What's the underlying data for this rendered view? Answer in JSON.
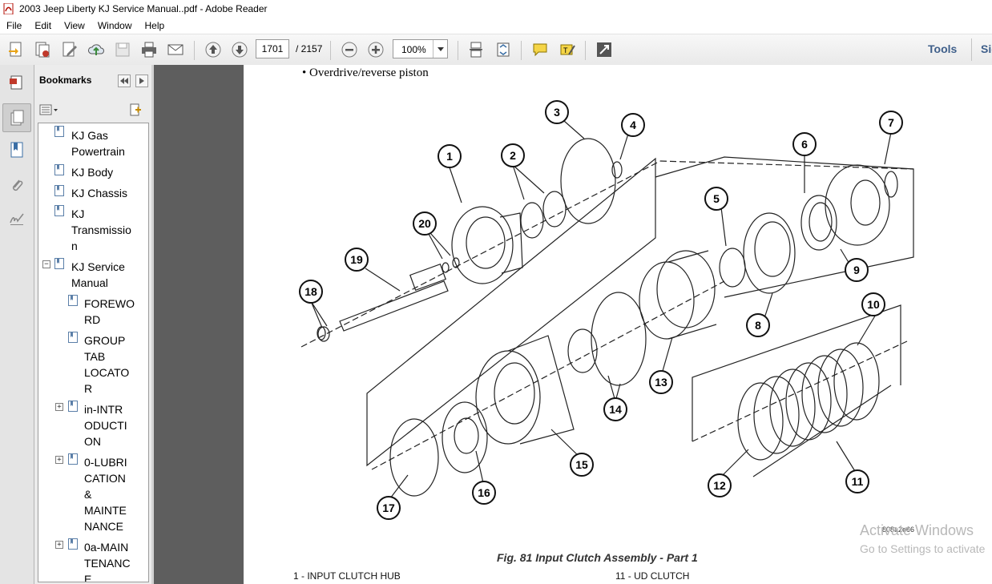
{
  "window": {
    "title": "2003 Jeep Liberty KJ Service Manual..pdf - Adobe Reader"
  },
  "menu": [
    "File",
    "Edit",
    "View",
    "Window",
    "Help"
  ],
  "toolbar": {
    "page_number": "1701",
    "page_total": "/ 2157",
    "zoom": "100%",
    "tools_label": "Tools",
    "sign_label": "Sig"
  },
  "bookmarks": {
    "header": "Bookmarks",
    "items": [
      {
        "lines": [
          "KJ Gas",
          "Powertrain"
        ]
      },
      {
        "lines": [
          "KJ Body"
        ]
      },
      {
        "lines": [
          "KJ Chassis"
        ]
      },
      {
        "lines": [
          "KJ",
          "Transmissio",
          "n"
        ]
      },
      {
        "lines": [
          "KJ Service",
          "Manual"
        ]
      },
      {
        "lines": [
          "FOREWO",
          "RD"
        ]
      },
      {
        "lines": [
          "GROUP",
          "TAB",
          "LOCATO",
          "R"
        ]
      },
      {
        "lines": [
          "in-INTR",
          "ODUCTI",
          "ON"
        ]
      },
      {
        "lines": [
          "0-LUBRI",
          "CATION",
          "&",
          "MAINTE",
          "NANCE"
        ]
      },
      {
        "lines": [
          "0a-MAIN",
          "TENANC",
          "E"
        ]
      }
    ]
  },
  "document": {
    "bullet_text": "Overdrive/reverse piston",
    "figure_caption": "Fig. 81 Input Clutch Assembly - Part 1",
    "callouts": [
      "1",
      "2",
      "3",
      "4",
      "5",
      "6",
      "7",
      "8",
      "9",
      "10",
      "11",
      "12",
      "13",
      "14",
      "15",
      "16",
      "17",
      "18",
      "19",
      "20"
    ],
    "part_number": "808a2e66",
    "legend": [
      "1 - INPUT CLUTCH HUB",
      "11 - UD CLUTCH"
    ]
  },
  "watermark": {
    "line1": "Activate Windows",
    "line2": "Go to Settings to activate"
  },
  "colors": {
    "toolbar_link": "#3f5f8a",
    "viewer_bg": "#5e5e5e",
    "panel_bg": "#ececec"
  }
}
